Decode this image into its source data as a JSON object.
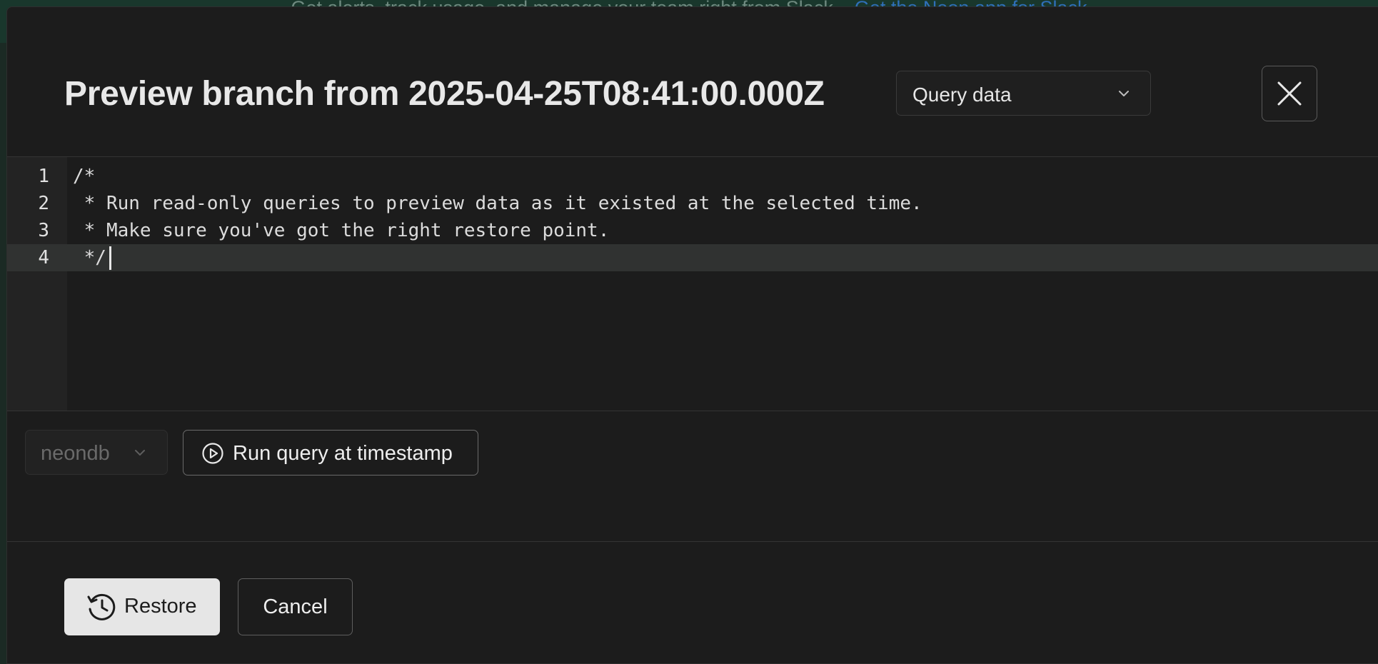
{
  "backdrop": {
    "banner_text": "Get alerts, track usage, and manage your team right from Slack.",
    "banner_link": "Get the Neon app for Slack"
  },
  "modal": {
    "title": "Preview branch from 2025-04-25T08:41:00.000Z",
    "mode_select": {
      "value": "Query data",
      "icon": "chevron-down-icon"
    },
    "close_icon": "close-icon"
  },
  "editor": {
    "lines": [
      {
        "num": "1",
        "code": "/*"
      },
      {
        "num": "2",
        "code": " * Run read-only queries to preview data as it existed at the selected time."
      },
      {
        "num": "3",
        "code": " * Make sure you've got the right restore point."
      },
      {
        "num": "4",
        "code": " */"
      }
    ],
    "active_line": 4
  },
  "toolbar": {
    "database_select": {
      "value": "neondb",
      "disabled": true
    },
    "run_button_label": "Run query at timestamp",
    "run_icon": "play-circle-icon"
  },
  "footer": {
    "restore_label": "Restore",
    "restore_icon": "history-clock-icon",
    "cancel_label": "Cancel"
  },
  "colors": {
    "modal_bg": "#1c1c1c",
    "active_line_bg": "#303231",
    "primary_button_bg": "#e6e6e6",
    "banner_link": "#2f6fb8"
  }
}
